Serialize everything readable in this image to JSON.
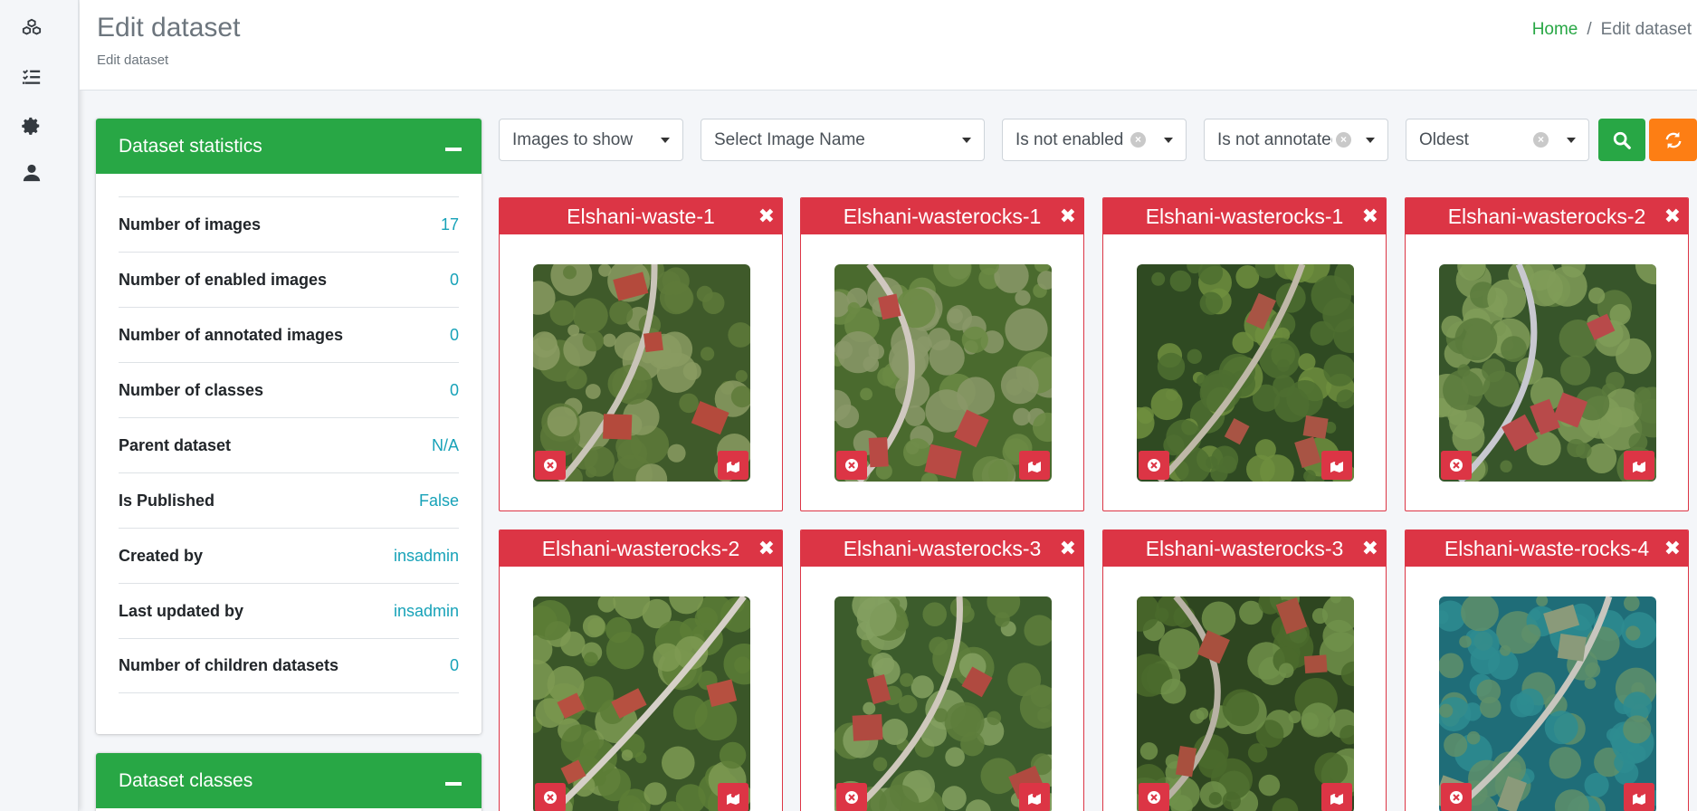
{
  "rail": {
    "icons": [
      "cubes-icon",
      "task-list-icon",
      "gear-icon",
      "user-icon"
    ]
  },
  "header": {
    "title": "Edit dataset",
    "subtitle": "Edit dataset",
    "breadcrumb": {
      "home": "Home",
      "current": "Edit dataset"
    }
  },
  "stats": {
    "title": "Dataset statistics",
    "rows": [
      {
        "label": "Number of images",
        "value": "17"
      },
      {
        "label": "Number of enabled images",
        "value": "0"
      },
      {
        "label": "Number of annotated images",
        "value": "0"
      },
      {
        "label": "Number of classes",
        "value": "0"
      },
      {
        "label": "Parent dataset",
        "value": "N/A"
      },
      {
        "label": "Is Published",
        "value": "False"
      },
      {
        "label": "Created by",
        "value": "insadmin"
      },
      {
        "label": "Last updated by",
        "value": "insadmin"
      },
      {
        "label": "Number of children datasets",
        "value": "0"
      }
    ]
  },
  "classes": {
    "title": "Dataset classes"
  },
  "filters": {
    "images_to_show": "Images to show",
    "image_name": "Select Image Name",
    "enabled": "Is not enabled",
    "annotated": "Is not annotated",
    "order": "Oldest"
  },
  "colors": {
    "primary_green": "#28a745",
    "danger_red": "#dc3545",
    "warning_orange": "#fd7e14",
    "info_teal": "#17a2b8"
  },
  "images": [
    {
      "title": "Elshani-waste-1"
    },
    {
      "title": "Elshani-wasterocks-1"
    },
    {
      "title": "Elshani-wasterocks-1"
    },
    {
      "title": "Elshani-wasterocks-2"
    },
    {
      "title": "Elshani-wasterocks-2"
    },
    {
      "title": "Elshani-wasterocks-3"
    },
    {
      "title": "Elshani-wasterocks-3"
    },
    {
      "title": "Elshani-waste-rocks-4"
    }
  ]
}
